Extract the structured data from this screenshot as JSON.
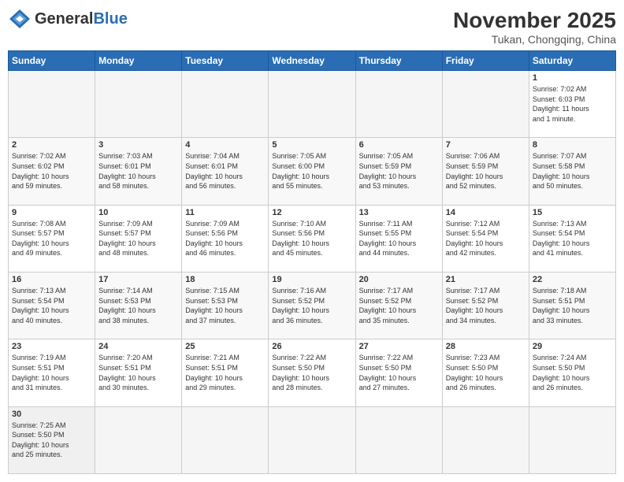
{
  "header": {
    "logo_general": "General",
    "logo_blue": "Blue",
    "month_title": "November 2025",
    "subtitle": "Tukan, Chongqing, China"
  },
  "days_of_week": [
    "Sunday",
    "Monday",
    "Tuesday",
    "Wednesday",
    "Thursday",
    "Friday",
    "Saturday"
  ],
  "weeks": [
    {
      "days": [
        {
          "number": "",
          "info": ""
        },
        {
          "number": "",
          "info": ""
        },
        {
          "number": "",
          "info": ""
        },
        {
          "number": "",
          "info": ""
        },
        {
          "number": "",
          "info": ""
        },
        {
          "number": "",
          "info": ""
        },
        {
          "number": "1",
          "info": "Sunrise: 7:02 AM\nSunset: 6:03 PM\nDaylight: 11 hours\nand 1 minute."
        }
      ]
    },
    {
      "days": [
        {
          "number": "2",
          "info": "Sunrise: 7:02 AM\nSunset: 6:02 PM\nDaylight: 10 hours\nand 59 minutes."
        },
        {
          "number": "3",
          "info": "Sunrise: 7:03 AM\nSunset: 6:01 PM\nDaylight: 10 hours\nand 58 minutes."
        },
        {
          "number": "4",
          "info": "Sunrise: 7:04 AM\nSunset: 6:01 PM\nDaylight: 10 hours\nand 56 minutes."
        },
        {
          "number": "5",
          "info": "Sunrise: 7:05 AM\nSunset: 6:00 PM\nDaylight: 10 hours\nand 55 minutes."
        },
        {
          "number": "6",
          "info": "Sunrise: 7:05 AM\nSunset: 5:59 PM\nDaylight: 10 hours\nand 53 minutes."
        },
        {
          "number": "7",
          "info": "Sunrise: 7:06 AM\nSunset: 5:59 PM\nDaylight: 10 hours\nand 52 minutes."
        },
        {
          "number": "8",
          "info": "Sunrise: 7:07 AM\nSunset: 5:58 PM\nDaylight: 10 hours\nand 50 minutes."
        }
      ]
    },
    {
      "days": [
        {
          "number": "9",
          "info": "Sunrise: 7:08 AM\nSunset: 5:57 PM\nDaylight: 10 hours\nand 49 minutes."
        },
        {
          "number": "10",
          "info": "Sunrise: 7:09 AM\nSunset: 5:57 PM\nDaylight: 10 hours\nand 48 minutes."
        },
        {
          "number": "11",
          "info": "Sunrise: 7:09 AM\nSunset: 5:56 PM\nDaylight: 10 hours\nand 46 minutes."
        },
        {
          "number": "12",
          "info": "Sunrise: 7:10 AM\nSunset: 5:56 PM\nDaylight: 10 hours\nand 45 minutes."
        },
        {
          "number": "13",
          "info": "Sunrise: 7:11 AM\nSunset: 5:55 PM\nDaylight: 10 hours\nand 44 minutes."
        },
        {
          "number": "14",
          "info": "Sunrise: 7:12 AM\nSunset: 5:54 PM\nDaylight: 10 hours\nand 42 minutes."
        },
        {
          "number": "15",
          "info": "Sunrise: 7:13 AM\nSunset: 5:54 PM\nDaylight: 10 hours\nand 41 minutes."
        }
      ]
    },
    {
      "days": [
        {
          "number": "16",
          "info": "Sunrise: 7:13 AM\nSunset: 5:54 PM\nDaylight: 10 hours\nand 40 minutes."
        },
        {
          "number": "17",
          "info": "Sunrise: 7:14 AM\nSunset: 5:53 PM\nDaylight: 10 hours\nand 38 minutes."
        },
        {
          "number": "18",
          "info": "Sunrise: 7:15 AM\nSunset: 5:53 PM\nDaylight: 10 hours\nand 37 minutes."
        },
        {
          "number": "19",
          "info": "Sunrise: 7:16 AM\nSunset: 5:52 PM\nDaylight: 10 hours\nand 36 minutes."
        },
        {
          "number": "20",
          "info": "Sunrise: 7:17 AM\nSunset: 5:52 PM\nDaylight: 10 hours\nand 35 minutes."
        },
        {
          "number": "21",
          "info": "Sunrise: 7:17 AM\nSunset: 5:52 PM\nDaylight: 10 hours\nand 34 minutes."
        },
        {
          "number": "22",
          "info": "Sunrise: 7:18 AM\nSunset: 5:51 PM\nDaylight: 10 hours\nand 33 minutes."
        }
      ]
    },
    {
      "days": [
        {
          "number": "23",
          "info": "Sunrise: 7:19 AM\nSunset: 5:51 PM\nDaylight: 10 hours\nand 31 minutes."
        },
        {
          "number": "24",
          "info": "Sunrise: 7:20 AM\nSunset: 5:51 PM\nDaylight: 10 hours\nand 30 minutes."
        },
        {
          "number": "25",
          "info": "Sunrise: 7:21 AM\nSunset: 5:51 PM\nDaylight: 10 hours\nand 29 minutes."
        },
        {
          "number": "26",
          "info": "Sunrise: 7:22 AM\nSunset: 5:50 PM\nDaylight: 10 hours\nand 28 minutes."
        },
        {
          "number": "27",
          "info": "Sunrise: 7:22 AM\nSunset: 5:50 PM\nDaylight: 10 hours\nand 27 minutes."
        },
        {
          "number": "28",
          "info": "Sunrise: 7:23 AM\nSunset: 5:50 PM\nDaylight: 10 hours\nand 26 minutes."
        },
        {
          "number": "29",
          "info": "Sunrise: 7:24 AM\nSunset: 5:50 PM\nDaylight: 10 hours\nand 26 minutes."
        }
      ]
    },
    {
      "days": [
        {
          "number": "30",
          "info": "Sunrise: 7:25 AM\nSunset: 5:50 PM\nDaylight: 10 hours\nand 25 minutes."
        },
        {
          "number": "",
          "info": ""
        },
        {
          "number": "",
          "info": ""
        },
        {
          "number": "",
          "info": ""
        },
        {
          "number": "",
          "info": ""
        },
        {
          "number": "",
          "info": ""
        },
        {
          "number": "",
          "info": ""
        }
      ]
    }
  ]
}
